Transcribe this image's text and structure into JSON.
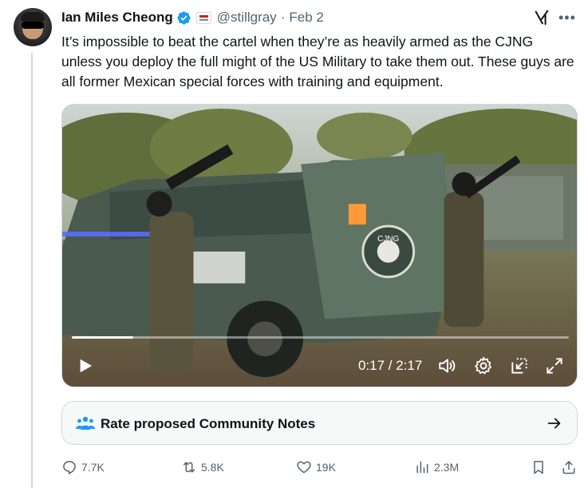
{
  "author": {
    "name": "Ian Miles Cheong",
    "handle": "@stillgray",
    "separator": "·",
    "date": "Feb 2"
  },
  "tweet": {
    "text": "It’s impossible to beat the cartel when they’re as heavily armed as the CJNG unless you deploy the full might of the US Military to take them out. These guys are all former Mexican special forces with training and equipment."
  },
  "video": {
    "time_display": "0:17 / 2:17",
    "progress": 0.124,
    "vehicle_text": "CJNG",
    "icons": [
      "play-icon",
      "volume-icon",
      "settings-gear-icon",
      "pip-icon",
      "fullscreen-icon"
    ]
  },
  "community_notes": {
    "label": "Rate proposed Community Notes"
  },
  "actions": {
    "replies": "7.7K",
    "reposts": "5.8K",
    "likes": "19K",
    "views": "2.3M"
  },
  "colors": {
    "verified": "#1d9bf0",
    "text_primary": "#0f1419",
    "text_secondary": "#536471",
    "border": "#cfd9de"
  }
}
